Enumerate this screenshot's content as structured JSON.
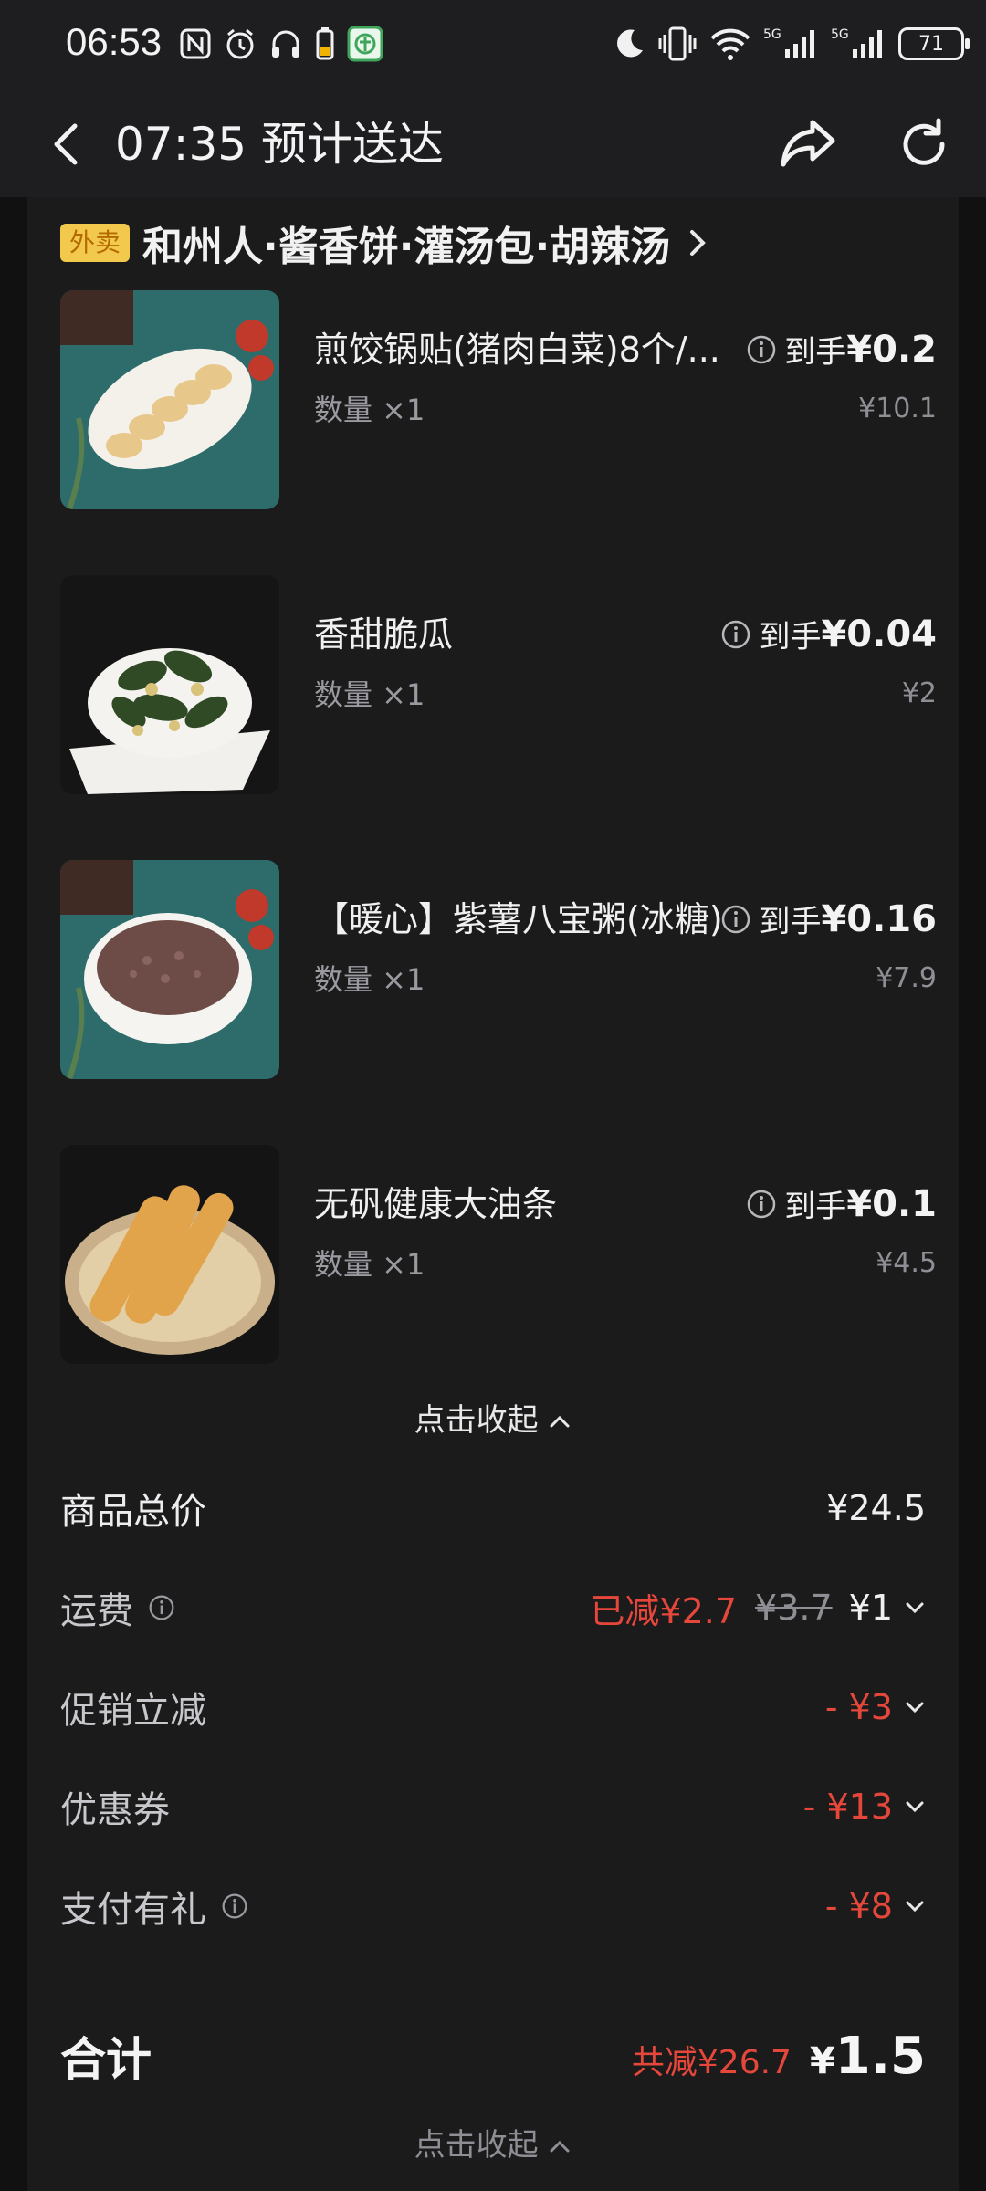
{
  "status_bar": {
    "time": "06:53",
    "battery": "71",
    "icons_left": [
      "nfc-icon",
      "alarm-icon",
      "headphones-icon",
      "battery-small-icon",
      "app-notification-icon"
    ],
    "icons_right": [
      "moon-icon",
      "vibrate-icon",
      "wifi-icon",
      "signal-5g-icon",
      "signal-5g-icon"
    ]
  },
  "header": {
    "eta_title": "07:35 预计送达"
  },
  "store": {
    "badge": "外卖",
    "name": "和州人·酱香饼·灌汤包·胡辣汤"
  },
  "products": [
    {
      "name": "煎饺锅贴(猪肉白菜)8个/...",
      "qty": "数量 ×1",
      "handle_label": "到手",
      "handle_price": "¥0.2",
      "original_price": "¥10.1"
    },
    {
      "name": "香甜脆瓜",
      "qty": "数量 ×1",
      "handle_label": "到手",
      "handle_price": "¥0.04",
      "original_price": "¥2"
    },
    {
      "name": "【暖心】紫薯八宝粥(冰糖)",
      "qty": "数量 ×1",
      "handle_label": "到手",
      "handle_price": "¥0.16",
      "original_price": "¥7.9"
    },
    {
      "name": "无矾健康大油条",
      "qty": "数量 ×1",
      "handle_label": "到手",
      "handle_price": "¥0.1",
      "original_price": "¥4.5"
    }
  ],
  "collapse_label": "点击收起",
  "summary": {
    "goods_total_label": "商品总价",
    "goods_total_value": "¥24.5",
    "delivery_label": "运费",
    "delivery_reduced": "已减¥2.7",
    "delivery_original": "¥3.7",
    "delivery_value": "¥1",
    "promo_label": "促销立减",
    "promo_value": "- ¥3",
    "coupon_label": "优惠券",
    "coupon_value": "- ¥13",
    "pay_gift_label": "支付有礼",
    "pay_gift_value": "- ¥8"
  },
  "total": {
    "label": "合计",
    "reduced": "共减¥26.7",
    "currency": "¥",
    "amount": "1.5"
  },
  "colors": {
    "accent_red": "#e5473b",
    "badge_yellow": "#f2c94c",
    "background": "#111112",
    "card": "#1b1b1c"
  }
}
